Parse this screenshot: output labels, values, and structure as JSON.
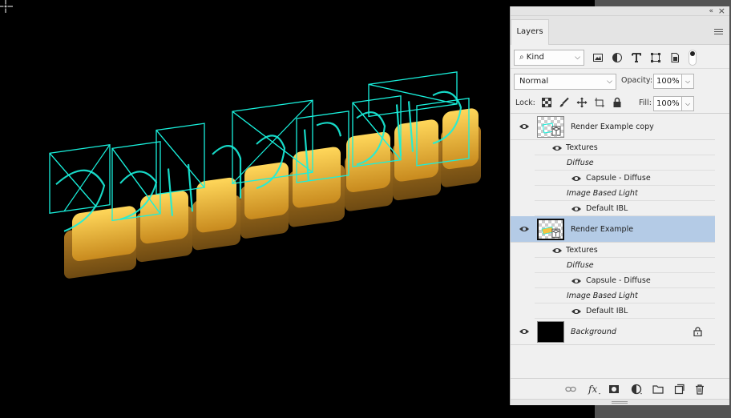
{
  "panel": {
    "tab_title": "Layers",
    "filter": {
      "kind_label": "Kind",
      "icons": [
        "image-filter-icon",
        "adjustment-filter-icon",
        "type-filter-icon",
        "shape-filter-icon",
        "smart-object-filter-icon"
      ]
    },
    "blend_mode": "Normal",
    "opacity_label": "Opacity:",
    "opacity_value": "100%",
    "lock_label": "Lock:",
    "fill_label": "Fill:",
    "fill_value": "100%"
  },
  "layers": [
    {
      "name": "Render Example copy",
      "selected": false,
      "sub": {
        "textures": "Textures",
        "diffuse": "Diffuse",
        "diffuse_item": "Capsule - Diffuse",
        "ibl": "Image Based Light",
        "ibl_item": "Default IBL"
      }
    },
    {
      "name": "Render Example",
      "selected": true,
      "sub": {
        "textures": "Textures",
        "diffuse": "Diffuse",
        "diffuse_item": "Capsule - Diffuse",
        "ibl": "Image Based Light",
        "ibl_item": "Default IBL"
      }
    },
    {
      "name": "Background",
      "selected": false
    }
  ],
  "colors": {
    "selected_row": "#b4cbe6",
    "wireframe": "#19f0dc",
    "text_3d": "#f5c242"
  }
}
